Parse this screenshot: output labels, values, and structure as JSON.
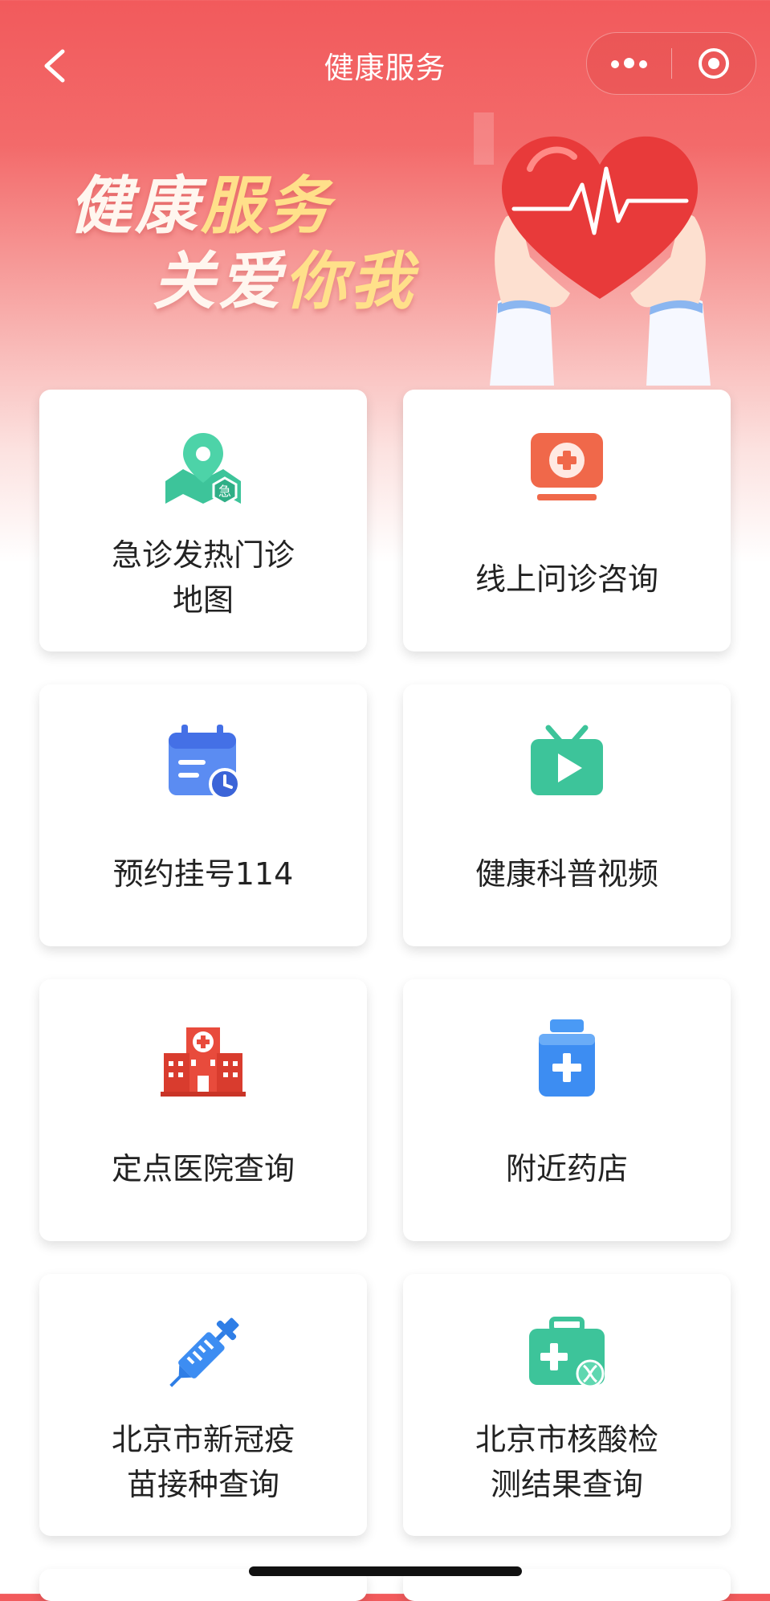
{
  "header": {
    "title": "健康服务"
  },
  "banner": {
    "line1_white": "健康",
    "line1_yellow": "服务",
    "line2_white": "关爱",
    "line2_yellow": "你我"
  },
  "services": [
    {
      "label_line1": "急诊发热门诊",
      "label_line2": "地图",
      "icon": "map-pin-emergency-icon",
      "color": "#3dc49a"
    },
    {
      "label_line1": "线上问诊咨询",
      "label_line2": "",
      "icon": "medical-screen-icon",
      "color": "#f06a4a"
    },
    {
      "label_line1": "预约挂号114",
      "label_line2": "",
      "icon": "calendar-clock-icon",
      "color": "#4c7ff0"
    },
    {
      "label_line1": "健康科普视频",
      "label_line2": "",
      "icon": "tv-play-icon",
      "color": "#3dc49a"
    },
    {
      "label_line1": "定点医院查询",
      "label_line2": "",
      "icon": "hospital-icon",
      "color": "#e84b3c"
    },
    {
      "label_line1": "附近药店",
      "label_line2": "",
      "icon": "medicine-bottle-icon",
      "color": "#3d8df2"
    },
    {
      "label_line1": "北京市新冠疫",
      "label_line2": "苗接种查询",
      "icon": "syringe-icon",
      "color": "#3d8df2"
    },
    {
      "label_line1": "北京市核酸检",
      "label_line2": "测结果查询",
      "icon": "medical-kit-dna-icon",
      "color": "#3dc49a"
    }
  ]
}
